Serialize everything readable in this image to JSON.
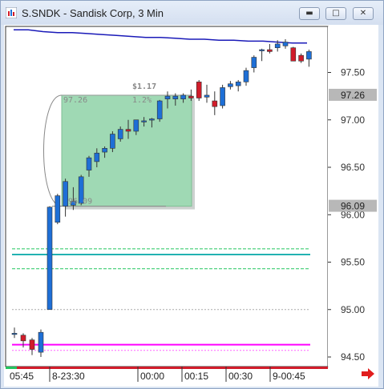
{
  "window": {
    "title": "S.SNDK - Sandisk Corp, 3 Min",
    "min_glyph": "▬",
    "max_glyph": "□",
    "close_glyph": "✕"
  },
  "chart_data": {
    "type": "candlestick",
    "title": "S.SNDK - Sandisk Corp, 3 Min",
    "y_ticks": [
      "97.50",
      "97.00",
      "96.50",
      "96.00",
      "95.50",
      "95.00",
      "94.50"
    ],
    "y_tick_values": [
      97.5,
      97.0,
      96.5,
      96.0,
      95.5,
      95.0,
      94.5
    ],
    "ylim": [
      94.45,
      97.98
    ],
    "x_ticks": [
      "05:45",
      "8-23:30",
      "00:00",
      "00:15",
      "00:30",
      "9-00:45"
    ],
    "price_labels": [
      {
        "text": "97.26",
        "value": 97.26
      },
      {
        "text": "96.09",
        "value": 96.09
      }
    ],
    "annotations": {
      "gain_label": "$1.17",
      "box_top_label": "97.26",
      "box_bottom_label": "96.09",
      "box_pct_label": "1.2%",
      "box_top": 97.26,
      "box_bottom": 96.09
    },
    "candles": [
      {
        "o": 94.74,
        "h": 94.81,
        "l": 94.7,
        "c": 94.75
      },
      {
        "o": 94.73,
        "h": 94.75,
        "l": 94.6,
        "c": 94.67
      },
      {
        "o": 94.68,
        "h": 94.7,
        "l": 94.52,
        "c": 94.58
      },
      {
        "o": 94.55,
        "h": 94.79,
        "l": 94.5,
        "c": 94.76
      },
      {
        "o": 95.0,
        "h": 96.09,
        "l": 95.0,
        "c": 96.08
      },
      {
        "o": 95.92,
        "h": 96.22,
        "l": 95.9,
        "c": 96.2
      },
      {
        "o": 96.09,
        "h": 96.38,
        "l": 95.98,
        "c": 96.35
      },
      {
        "o": 96.1,
        "h": 96.29,
        "l": 96.05,
        "c": 96.14
      },
      {
        "o": 96.12,
        "h": 96.42,
        "l": 96.1,
        "c": 96.4
      },
      {
        "o": 96.47,
        "h": 96.62,
        "l": 96.4,
        "c": 96.6
      },
      {
        "o": 96.56,
        "h": 96.7,
        "l": 96.5,
        "c": 96.65
      },
      {
        "o": 96.66,
        "h": 96.72,
        "l": 96.6,
        "c": 96.7
      },
      {
        "o": 96.7,
        "h": 96.88,
        "l": 96.66,
        "c": 96.85
      },
      {
        "o": 96.8,
        "h": 96.93,
        "l": 96.77,
        "c": 96.9
      },
      {
        "o": 96.9,
        "h": 97.0,
        "l": 96.8,
        "c": 96.88
      },
      {
        "o": 96.88,
        "h": 97.0,
        "l": 96.84,
        "c": 97.0
      },
      {
        "o": 96.98,
        "h": 97.03,
        "l": 96.93,
        "c": 96.99
      },
      {
        "o": 97.0,
        "h": 97.02,
        "l": 96.92,
        "c": 97.01
      },
      {
        "o": 97.01,
        "h": 97.21,
        "l": 96.98,
        "c": 97.2
      },
      {
        "o": 97.22,
        "h": 97.3,
        "l": 97.12,
        "c": 97.25
      },
      {
        "o": 97.22,
        "h": 97.28,
        "l": 97.15,
        "c": 97.25
      },
      {
        "o": 97.22,
        "h": 97.28,
        "l": 97.18,
        "c": 97.26
      },
      {
        "o": 97.25,
        "h": 97.32,
        "l": 97.2,
        "c": 97.23
      },
      {
        "o": 97.4,
        "h": 97.42,
        "l": 97.2,
        "c": 97.23
      },
      {
        "o": 97.24,
        "h": 97.37,
        "l": 97.18,
        "c": 97.26
      },
      {
        "o": 97.2,
        "h": 97.3,
        "l": 97.05,
        "c": 97.14
      },
      {
        "o": 97.15,
        "h": 97.37,
        "l": 97.12,
        "c": 97.34
      },
      {
        "o": 97.35,
        "h": 97.41,
        "l": 97.32,
        "c": 97.38
      },
      {
        "o": 97.36,
        "h": 97.42,
        "l": 97.3,
        "c": 97.4
      },
      {
        "o": 97.4,
        "h": 97.55,
        "l": 97.36,
        "c": 97.52
      },
      {
        "o": 97.55,
        "h": 97.68,
        "l": 97.5,
        "c": 97.66
      },
      {
        "o": 97.74,
        "h": 97.75,
        "l": 97.62,
        "c": 97.74
      },
      {
        "o": 97.74,
        "h": 97.8,
        "l": 97.7,
        "c": 97.72
      },
      {
        "o": 97.76,
        "h": 97.84,
        "l": 97.72,
        "c": 97.8
      },
      {
        "o": 97.78,
        "h": 97.85,
        "l": 97.75,
        "c": 97.82
      },
      {
        "o": 97.76,
        "h": 97.77,
        "l": 97.62,
        "c": 97.62
      },
      {
        "o": 97.68,
        "h": 97.7,
        "l": 97.6,
        "c": 97.62
      },
      {
        "o": 97.64,
        "h": 97.74,
        "l": 97.56,
        "c": 97.72
      }
    ],
    "blue_line": [
      97.95,
      97.95,
      97.93,
      97.92,
      97.92,
      97.91,
      97.9,
      97.89,
      97.88,
      97.87,
      97.87,
      97.86,
      97.85,
      97.85,
      97.84,
      97.84,
      97.83,
      97.83,
      97.82,
      97.81,
      97.81
    ],
    "hlines": [
      {
        "value": 95.64,
        "color": "#22c55e",
        "style": "dashed"
      },
      {
        "value": 95.58,
        "color": "#22b2b2",
        "style": "solid"
      },
      {
        "value": 95.43,
        "color": "#22c55e",
        "style": "dashed"
      },
      {
        "value": 95.0,
        "color": "#aaaaaa",
        "style": "dotted"
      },
      {
        "value": 94.63,
        "color": "#ff00ff",
        "style": "solid"
      },
      {
        "value": 94.57,
        "color": "#ff66ff",
        "style": "dotted"
      }
    ],
    "colors": {
      "up": "#1e6fd6",
      "down": "#d11c2a",
      "box_fill": "#9fd9b4",
      "label_bg": "#b8b8b8",
      "blue_line": "#1a1ab8"
    }
  }
}
